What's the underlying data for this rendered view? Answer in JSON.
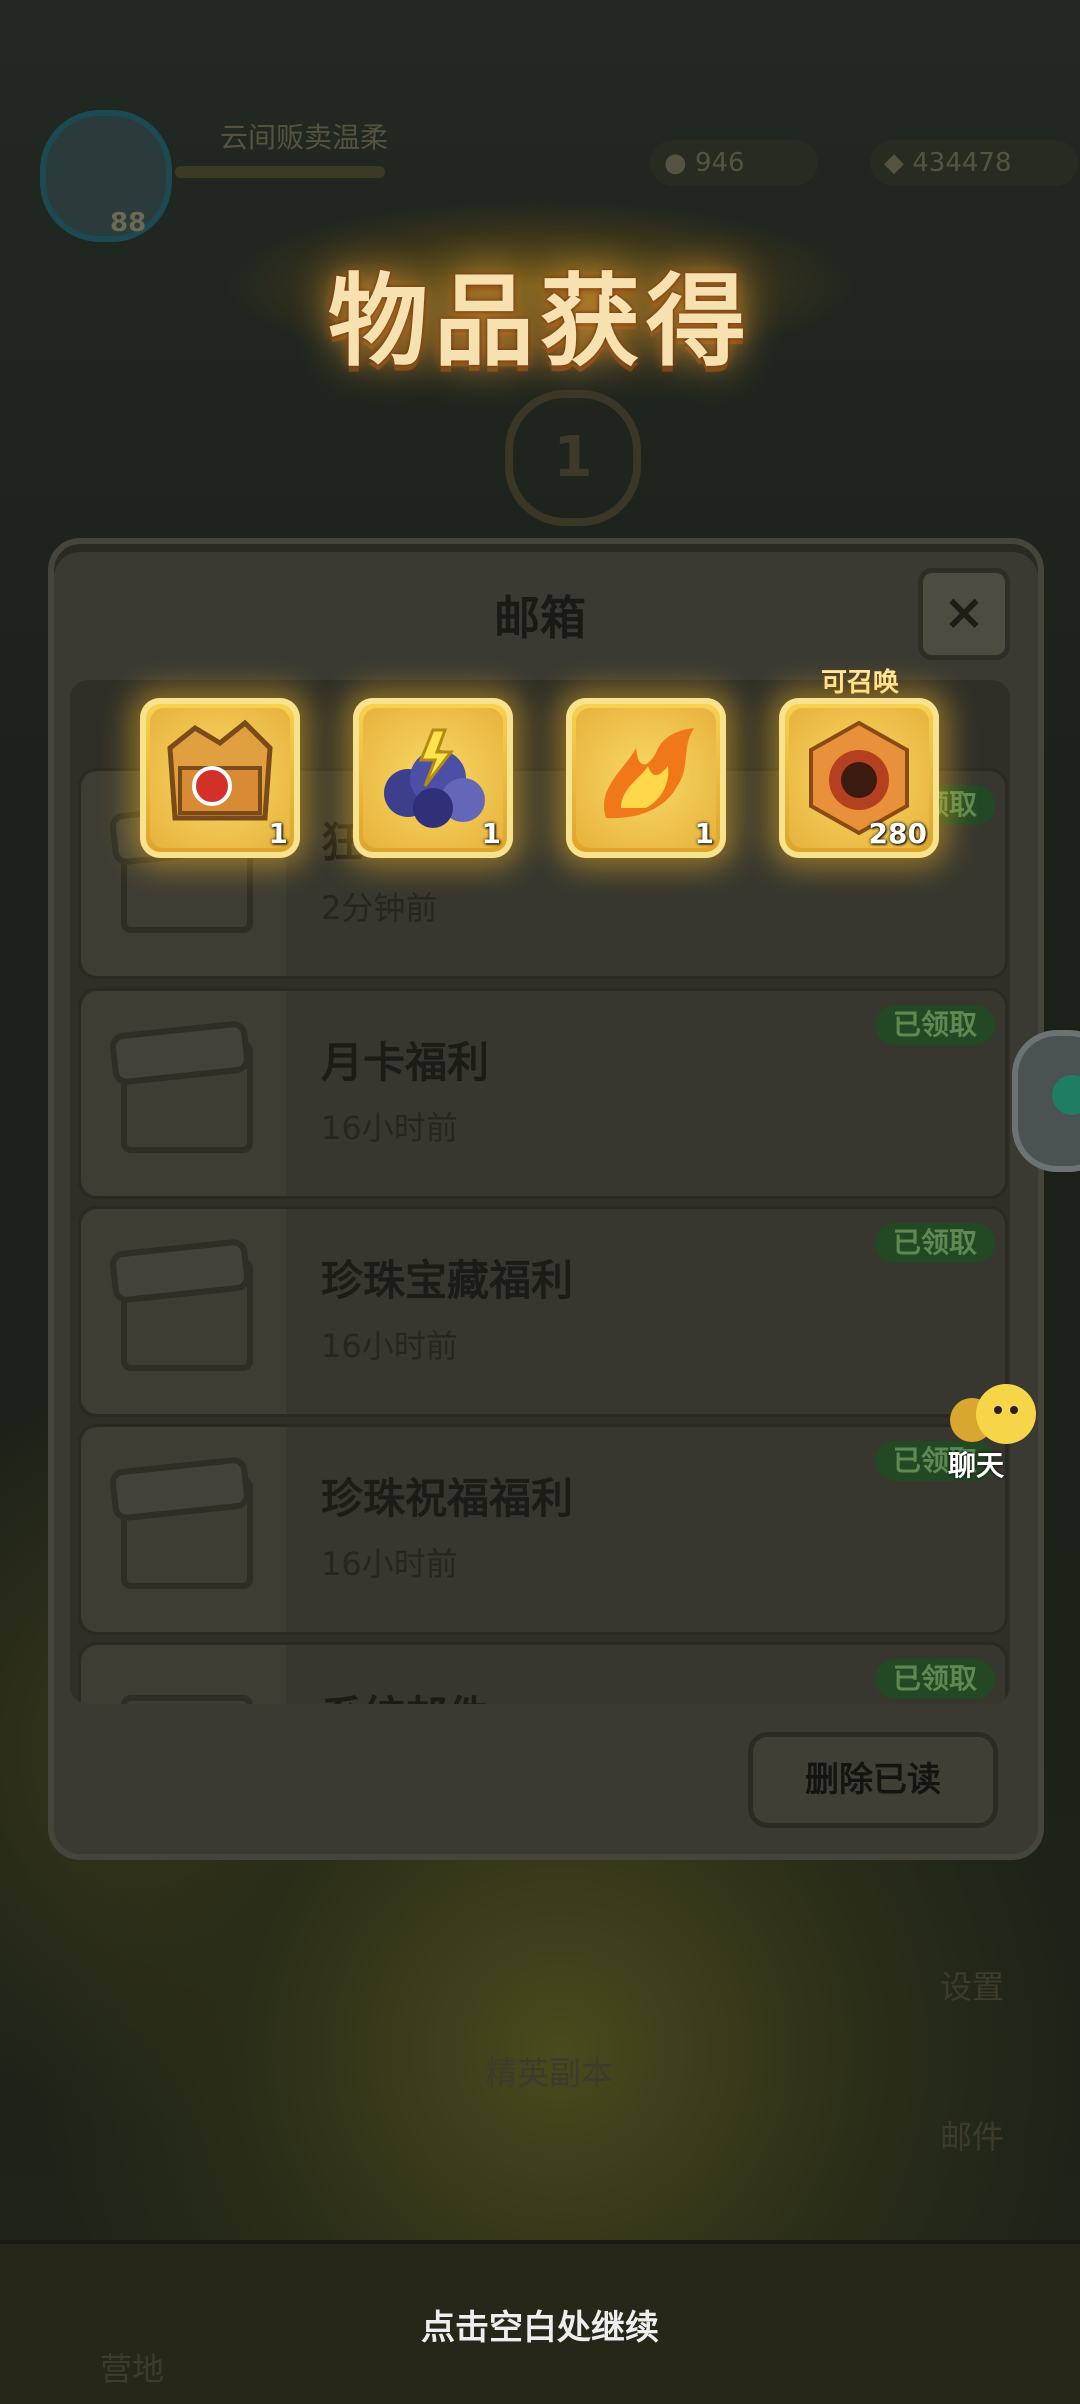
{
  "hud": {
    "player_name": "云间贩卖温柔",
    "level": "88",
    "currency_1": "946",
    "currency_2": "434478"
  },
  "title": "物品获得",
  "rank_number": "1",
  "rewards": [
    {
      "icon": "treasure-chest-icon",
      "count": "1"
    },
    {
      "icon": "thunder-cloud-icon",
      "count": "1"
    },
    {
      "icon": "fire-flame-icon",
      "count": "1"
    },
    {
      "icon": "summon-stone-icon",
      "count": "280",
      "tag": "可召唤"
    }
  ],
  "mailbox": {
    "title": "邮箱",
    "close": "×",
    "mails": [
      {
        "title": "狂",
        "time": "2分钟前",
        "status": "已领取"
      },
      {
        "title": "月卡福利",
        "time": "16小时前",
        "status": "已领取"
      },
      {
        "title": "珍珠宝藏福利",
        "time": "16小时前",
        "status": "已领取"
      },
      {
        "title": "珍珠祝福福利",
        "time": "16小时前",
        "status": "已领取"
      },
      {
        "title": "系统邮件",
        "time": "",
        "status": "已领取"
      }
    ],
    "delete_read": "删除已读"
  },
  "side": {
    "chat_label": "聊天",
    "settings_label": "设置",
    "mail_label": "邮件",
    "elite_dungeon": "精英副本",
    "camp": "营地"
  },
  "continue_hint": "点击空白处继续",
  "colors": {
    "gold": "#f0c040",
    "claimed_green": "#224824",
    "title_text": "#f7e1b0"
  }
}
